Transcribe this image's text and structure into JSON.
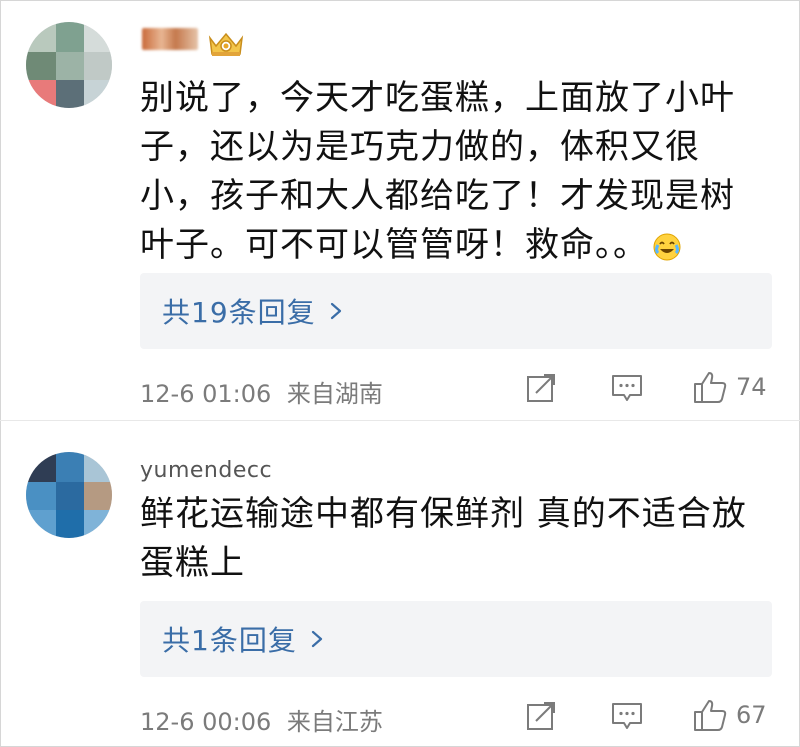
{
  "comments": [
    {
      "username": "",
      "has_badge": true,
      "text_lines": [
        "别说了，今天才吃蛋糕，上面放了小叶",
        "子，还以为是巧克力做的，体积又很",
        "小，孩子和大人都给吃了！才发现是树",
        "叶子。可不可以管管呀！救命。。"
      ],
      "emoji": "laugh-cry-emoji",
      "replies_label": "共19条回复",
      "timestamp": "12-6 01:06",
      "location": "来自湖南",
      "likes": "74"
    },
    {
      "username": "yumendecc",
      "has_badge": false,
      "text_lines": [
        "鲜花运输途中都有保鲜剂 真的不适合放",
        "蛋糕上"
      ],
      "emoji": "",
      "replies_label": "共1条回复",
      "timestamp": "12-6 00:06",
      "location": "来自江苏",
      "likes": "67"
    }
  ],
  "icons": {
    "share": "share-icon",
    "comment": "comment-icon",
    "like": "thumbs-up-icon",
    "chevron": "chevron-right-icon"
  },
  "colors": {
    "reply_link": "#3a6da7",
    "meta_text": "#7b7b7b",
    "reply_box_bg": "#f3f4f6"
  }
}
